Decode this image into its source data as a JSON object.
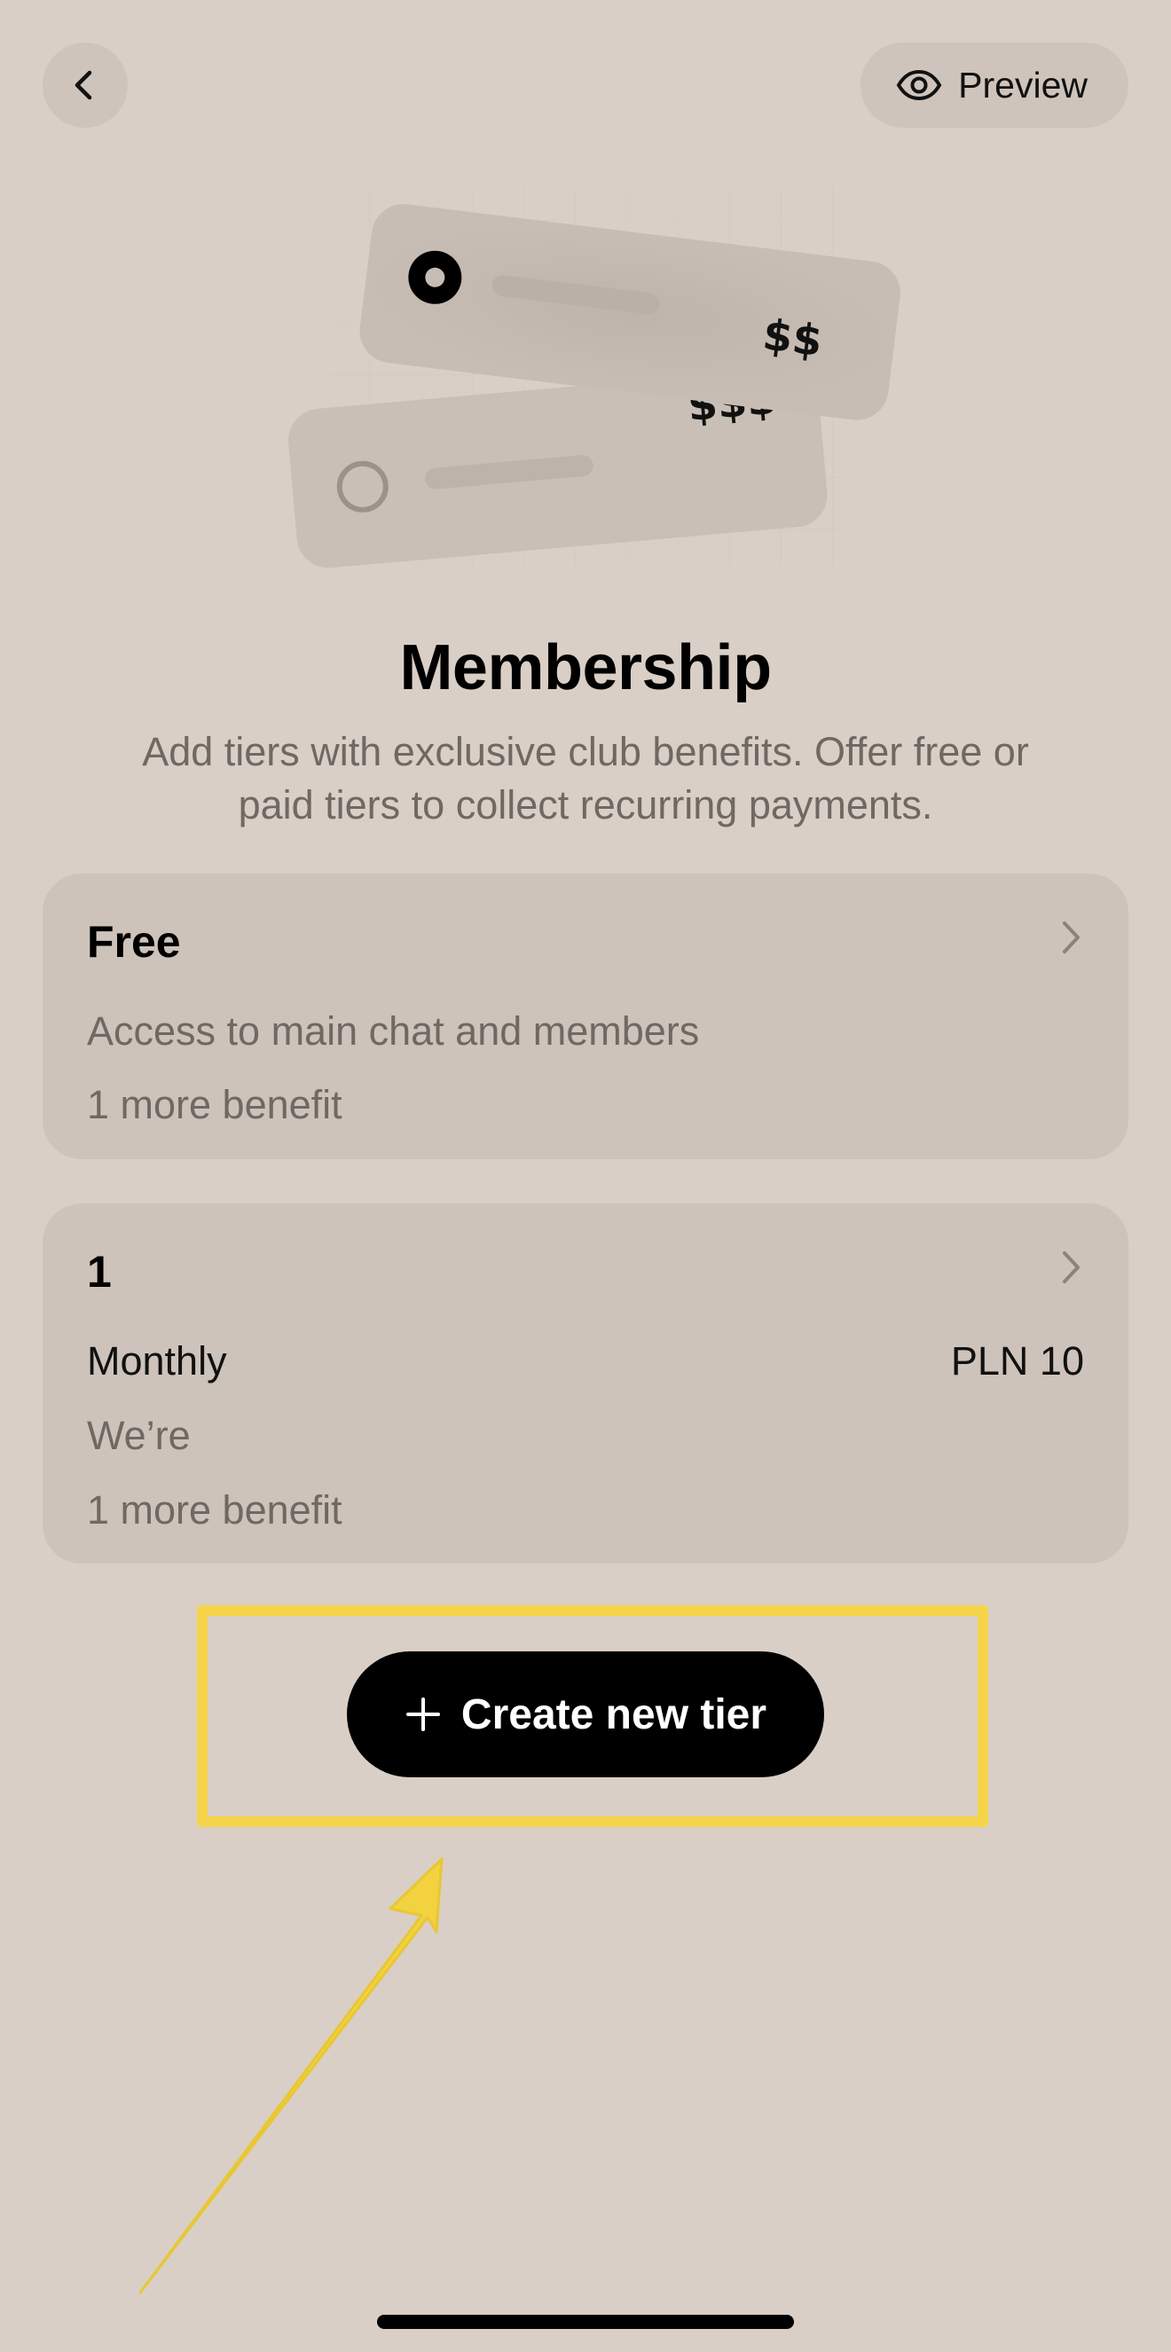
{
  "header": {
    "back_icon": "chevron-left-icon",
    "preview_icon": "eye-icon",
    "preview_label": "Preview"
  },
  "illustration": {
    "front_card_price": "$$",
    "back_card_price": "$$$"
  },
  "page": {
    "title": "Membership",
    "subtitle": "Add tiers with exclusive club benefits. Offer free or paid tiers to collect recurring payments."
  },
  "tiers": [
    {
      "name": "Free",
      "benefit": "Access to main chat and members",
      "more": "1 more benefit"
    },
    {
      "name": "1",
      "period": "Monthly",
      "price": "PLN 10",
      "benefit": "We’re",
      "more": "1 more benefit"
    }
  ],
  "actions": {
    "create_icon": "plus-icon",
    "create_label": "Create new tier"
  },
  "annotation": {
    "highlight_color": "#f6d44a"
  }
}
